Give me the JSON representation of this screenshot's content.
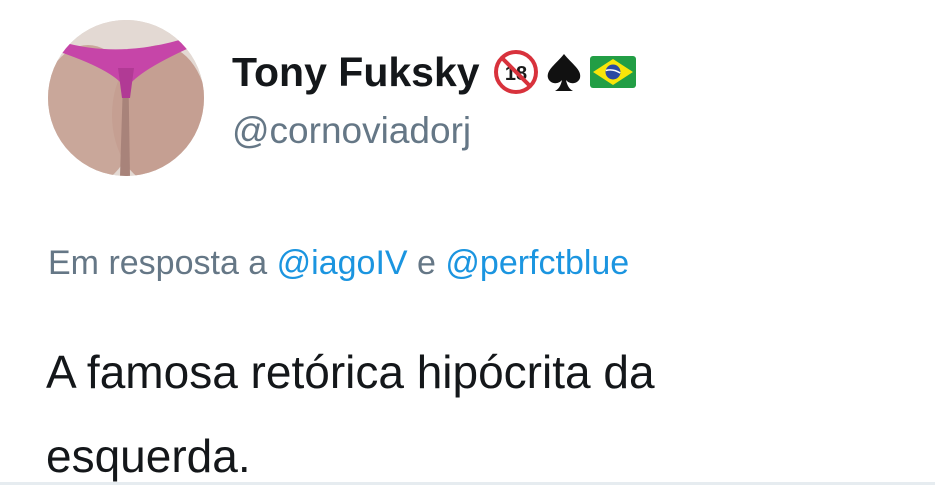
{
  "user": {
    "display_name": "Tony Fuksky",
    "handle": "@cornoviadorj",
    "avatar": "profile-photo",
    "badges": [
      "no-under-18-icon",
      "spade-icon",
      "brazil-flag-icon"
    ]
  },
  "reply": {
    "prefix": "Em resposta a ",
    "mention_1": "@iagoIV",
    "conjunction": " e ",
    "mention_2": "@perfctblue"
  },
  "tweet": {
    "text_line_1": "A famosa retórica hipócrita da",
    "text_line_2": "esquerda."
  },
  "colors": {
    "text": "#14171a",
    "secondary": "#657786",
    "link": "#1b95e0",
    "no18_red": "#d8323c",
    "flag_green": "#229e45",
    "flag_yellow": "#f8e509",
    "flag_blue": "#2b49a3"
  }
}
